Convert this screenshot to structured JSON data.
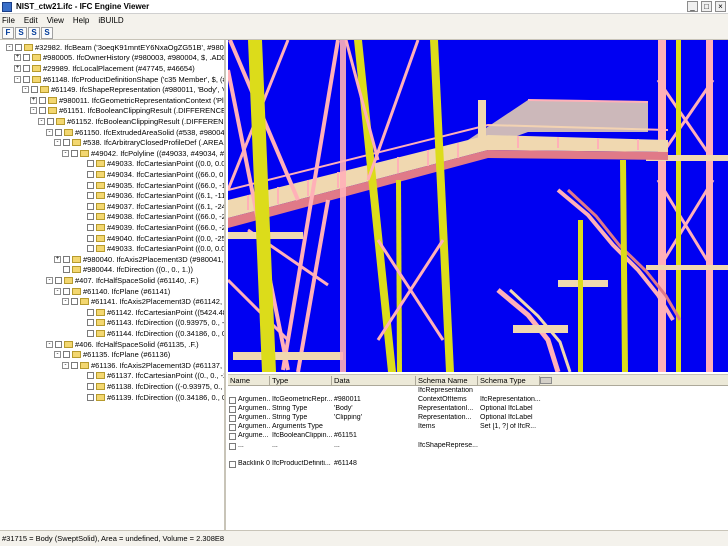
{
  "window": {
    "title": "NIST_ctw21.ifc - IFC Engine Viewer",
    "buttons": {
      "minimize": "_",
      "maximize": "□",
      "close": "×"
    }
  },
  "menu": [
    "File",
    "Edit",
    "View",
    "Help",
    "iBUILD"
  ],
  "toolbar": [
    "F",
    "S",
    "S",
    "S"
  ],
  "tree": [
    {
      "toggle": "-",
      "label": "#32982. IfcBeam ('3oeqK91mntEY6NxaOgZG51B', #980005, 'c35 Memb"
    },
    {
      "toggle": "+",
      "label": "#980005. IfcOwnerHistory (#980003, #980004, $, .ADDED., $, $,"
    },
    {
      "toggle": "+",
      "label": "#29989. IfcLocalPlacement (#47745, #46654)"
    },
    {
      "toggle": "-",
      "label": "#61148. IfcProductDefinitionShape ('c35 Member', $, (#61149))"
    },
    {
      "toggle": "-",
      "label": "#61149. IfcShapeRepresentation (#980011, 'Body', 'Clipping', (#"
    },
    {
      "toggle": "+",
      "label": "#980011. IfcGeometricRepresentationContext ('Plan', 'Design"
    },
    {
      "toggle": "-",
      "label": "#61151. IfcBooleanClippingResult (.DIFFERENCE., #61152, #"
    },
    {
      "toggle": "-",
      "label": "#61152. IfcBooleanClippingResult (.DIFFERENCE., #61150"
    },
    {
      "toggle": "-",
      "label": "#61150. IfcExtrudedAreaSolid (#538, #980040, #980"
    },
    {
      "toggle": "-",
      "label": "#538. IfcArbitraryClosedProfileDef (.AREA., 'C10X15"
    },
    {
      "toggle": "-",
      "label": "#49042. IfcPolyline ((#49033, #49034, #49035"
    },
    {
      "toggle": "",
      "label": "#49033. IfcCartesianPoint ((0.0, 0.0))"
    },
    {
      "toggle": "",
      "label": "#49034. IfcCartesianPoint ((66.0, 0.0))"
    },
    {
      "toggle": "",
      "label": "#49035. IfcCartesianPoint ((66.0, -11.1))"
    },
    {
      "toggle": "",
      "label": "#49036. IfcCartesianPoint ((6.1, -11.1))"
    },
    {
      "toggle": "",
      "label": "#49037. IfcCartesianPoint ((6.1, -242.9))"
    },
    {
      "toggle": "",
      "label": "#49038. IfcCartesianPoint ((66.0, -242.9))"
    },
    {
      "toggle": "",
      "label": "#49039. IfcCartesianPoint ((66.0, -254.0))"
    },
    {
      "toggle": "",
      "label": "#49040. IfcCartesianPoint ((0.0, -254.0))"
    },
    {
      "toggle": "",
      "label": "#49033. IfcCartesianPoint ((0.0, 0.0))"
    },
    {
      "toggle": "+",
      "label": "#980040. IfcAxis2Placement3D (#980041, #980"
    },
    {
      "toggle": "",
      "label": "#980044. IfcDirection ((0., 0., 1.))"
    },
    {
      "toggle": "-",
      "label": "#407. IfcHalfSpaceSolid (#61140, .F.)"
    },
    {
      "toggle": "-",
      "label": "#61140. IfcPlane (#61141)"
    },
    {
      "toggle": "-",
      "label": "#61141. IfcAxis2Placement3D (#61142, #61143"
    },
    {
      "toggle": "",
      "label": "#61142. IfcCartesianPoint ((5424.4875, 0., 0."
    },
    {
      "toggle": "",
      "label": "#61143. IfcDirection ((0.93975, 0., -0.34185"
    },
    {
      "toggle": "",
      "label": "#61144. IfcDirection ((0.34186, 0., 0.93975"
    },
    {
      "toggle": "-",
      "label": "#406. IfcHalfSpaceSolid (#61135, .F.)"
    },
    {
      "toggle": "-",
      "label": "#61135. IfcPlane (#61136)"
    },
    {
      "toggle": "-",
      "label": "#61136. IfcAxis2Placement3D (#61137, #61138, #"
    },
    {
      "toggle": "",
      "label": "#61137. IfcCartesianPoint ((0., 0., -253.99941))"
    },
    {
      "toggle": "",
      "label": "#61138. IfcDirection ((-0.93975, 0., 0.34186))"
    },
    {
      "toggle": "",
      "label": "#61139. IfcDirection ((0.34186, 0., 0.93975))"
    }
  ],
  "properties": {
    "columns": [
      "Name",
      "Type",
      "Data",
      "Schema Name",
      "Schema Type"
    ],
    "rows": [
      [
        "",
        "",
        "",
        "IfcRepresentation",
        ""
      ],
      [
        "Argumen...",
        "IfcGeometricRepr...",
        "#980011",
        "ContextOfItems",
        "IfcRepresentation..."
      ],
      [
        "Argumen...",
        "String Type",
        "'Body'",
        "RepresentationI...",
        "Optional IfcLabel"
      ],
      [
        "Argumen...",
        "String Type",
        "'Clipping'",
        "Representation...",
        "Optional IfcLabel"
      ],
      [
        "Argumen...",
        "Arguments Type",
        "",
        "Items",
        "Set [1, ?] of IfcR..."
      ],
      [
        "Argume...",
        "IfcBooleanClippin...",
        "#61151",
        "",
        ""
      ],
      [
        "...",
        "...",
        "...",
        "IfcShapeReprese...",
        ""
      ],
      [
        "",
        "",
        "",
        "",
        ""
      ],
      [
        "Backlink 0",
        "IfcProductDefiniti...",
        "#61148",
        "",
        ""
      ]
    ]
  },
  "status": "#31715 = Body (SweptSolid), Area = undefined, Volume = 2.308E8",
  "colors": {
    "viewport_bg": "#0000f2",
    "column_yellow": "#dcdc1a",
    "steel_pink": "#ffb0b8",
    "steel_pink_dark": "#e07a88",
    "platform_tan": "#f0d8b0"
  },
  "icons": [
    "app-icon",
    "tree-toggle-icon",
    "node-box-icon",
    "folder-icon",
    "argument-icon"
  ]
}
